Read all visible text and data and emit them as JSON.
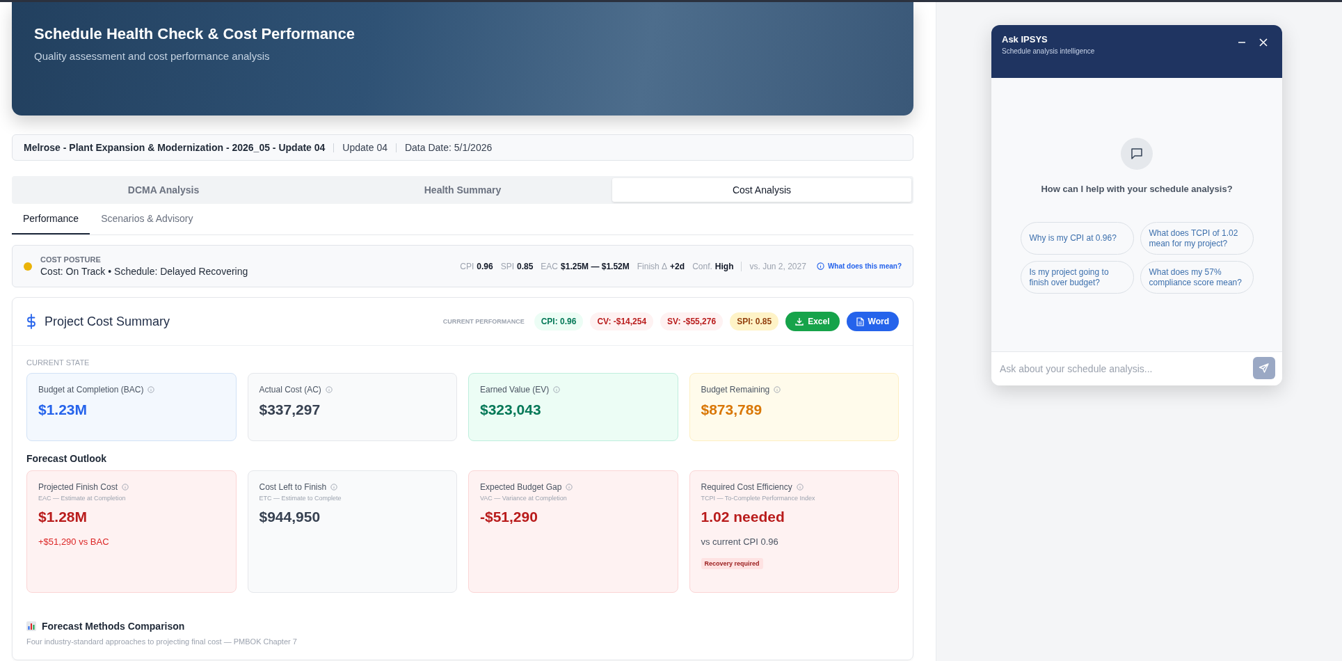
{
  "header": {
    "title": "Schedule Health Check & Cost Performance",
    "subtitle": "Quality assessment and cost performance analysis"
  },
  "project_bar": {
    "project": "Melrose - Plant Expansion & Modernization - 2026_05 - Update 04",
    "update": "Update 04",
    "data_date": "Data Date: 5/1/2026"
  },
  "tabs": [
    {
      "label": "DCMA Analysis",
      "selected": false
    },
    {
      "label": "Health Summary",
      "selected": false
    },
    {
      "label": "Cost Analysis",
      "selected": true
    }
  ],
  "subtabs": [
    {
      "label": "Performance",
      "selected": true
    },
    {
      "label": "Scenarios & Advisory",
      "selected": false
    }
  ],
  "cost_posture": {
    "label": "COST POSTURE",
    "status": "Cost: On Track • Schedule: Delayed Recovering",
    "color": "#eab308",
    "metrics": [
      {
        "label": "CPI",
        "value": "0.96"
      },
      {
        "label": "SPI",
        "value": "0.85"
      },
      {
        "label": "EAC",
        "value": "$1.25M — $1.52M"
      },
      {
        "label": "Finish Δ",
        "value": "+2d"
      },
      {
        "label": "Conf.",
        "value": "High"
      }
    ],
    "compare": "vs. Jun 2, 2027",
    "help_link": "What does this mean?"
  },
  "summary": {
    "title": "Project Cost Summary",
    "performance_label": "CURRENT PERFORMANCE",
    "pills": [
      {
        "text": "CPI: 0.96",
        "kind": "good"
      },
      {
        "text": "CV: -$14,254",
        "kind": "bad"
      },
      {
        "text": "SV: -$55,276",
        "kind": "bad"
      },
      {
        "text": "SPI: 0.85",
        "kind": "warn"
      }
    ],
    "buttons": [
      {
        "label": "Excel",
        "kind": "excel"
      },
      {
        "label": "Word",
        "kind": "word"
      }
    ],
    "current_state_label": "CURRENT STATE",
    "current_state": [
      {
        "label": "Budget at Completion (BAC)",
        "value": "$1.23M",
        "kind": "blue"
      },
      {
        "label": "Actual Cost (AC)",
        "value": "$337,297",
        "kind": "gray"
      },
      {
        "label": "Earned Value (EV)",
        "value": "$323,043",
        "kind": "green"
      },
      {
        "label": "Budget Remaining",
        "value": "$873,789",
        "kind": "amber"
      }
    ],
    "forecast_label": "Forecast Outlook",
    "forecast": [
      {
        "label": "Projected Finish Cost",
        "sublabel": "EAC — Estimate at Completion",
        "value": "$1.28M",
        "kind": "red",
        "note": "+$51,290 vs BAC"
      },
      {
        "label": "Cost Left to Finish",
        "sublabel": "ETC — Estimate to Complete",
        "value": "$944,950",
        "kind": "gray"
      },
      {
        "label": "Expected Budget Gap",
        "sublabel": "VAC — Variance at Completion",
        "value": "-$51,290",
        "kind": "red"
      },
      {
        "label": "Required Cost Efficiency",
        "sublabel": "TCPI — To-Complete Performance Index",
        "value": "1.02 needed",
        "kind": "red",
        "note": "vs current CPI 0.96",
        "badge": "Recovery required"
      }
    ],
    "methods_title": "Forecast Methods Comparison",
    "methods_subtitle": "Four industry-standard approaches to projecting final cost — PMBOK Chapter 7"
  },
  "chat": {
    "title": "Ask IPSYS",
    "subtitle": "Schedule analysis intelligence",
    "prompt": "How can I help with your schedule analysis?",
    "suggestions": [
      "Why is my CPI at 0.96?",
      "What does TCPI of 1.02 mean for my project?",
      "Is my project going to finish over budget?",
      "What does my 57% compliance score mean?"
    ],
    "input": {
      "placeholder": "Ask about your schedule analysis..."
    }
  }
}
